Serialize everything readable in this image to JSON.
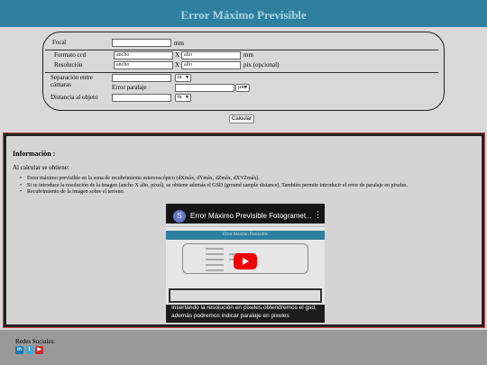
{
  "header": {
    "title": "Error Máximo Previsible"
  },
  "form": {
    "focal": {
      "label": "Focal",
      "value": "",
      "unit": "mm"
    },
    "formato": {
      "label": "Formato ccd",
      "ancho": "ancho",
      "sep": "X",
      "alto": "alto",
      "unit": "mm"
    },
    "resolucion": {
      "label": "Resolución",
      "ancho": "ancho",
      "sep": "X",
      "alto": "alto",
      "unit": "pix (opcional)"
    },
    "separacion": {
      "label": "Separación entre cámaras",
      "value": "",
      "unit": "m"
    },
    "paralaje": {
      "label": "Error paralaje",
      "value": "",
      "unit": "µm"
    },
    "distancia": {
      "label": "Distancia al objeto",
      "value": "",
      "unit": "m"
    },
    "calcular": "Calcular"
  },
  "info": {
    "title": "Informaciòn :",
    "intro": "Al calcular se obtiene:",
    "bullets": [
      "Error máximo previsible en la zona de recubrimiento estereoscópico (dXmáx, dYmáx, dZmáx, dXYZmáx).",
      "Si se introduce la resolución de la imagen (ancho X alto, pixel), se obtiene además el GSD (ground sample distance). También permite introducir el error de paralaje en pixeles.",
      "Recubrimiento de la imagen sobre el terreno."
    ],
    "video": {
      "avatar": "S",
      "title": "Error Máximo Previsible Fotogramet...",
      "inner_title": "Error Máximo Previsible",
      "caption_line1": "Insertando la resolución en pixeles obtendremos el gsd,",
      "caption_line2": "además podremos indicar paralaje en pixeles"
    }
  },
  "footer": {
    "label": "Redes Sociales:",
    "icons": [
      {
        "name": "linkedin-icon",
        "glyph": "in",
        "color": "#1b74b4"
      },
      {
        "name": "twitter-icon",
        "glyph": "t",
        "color": "#4aa5d8"
      },
      {
        "name": "youtube-icon",
        "glyph": "▶",
        "color": "#cc2b2b"
      }
    ]
  }
}
